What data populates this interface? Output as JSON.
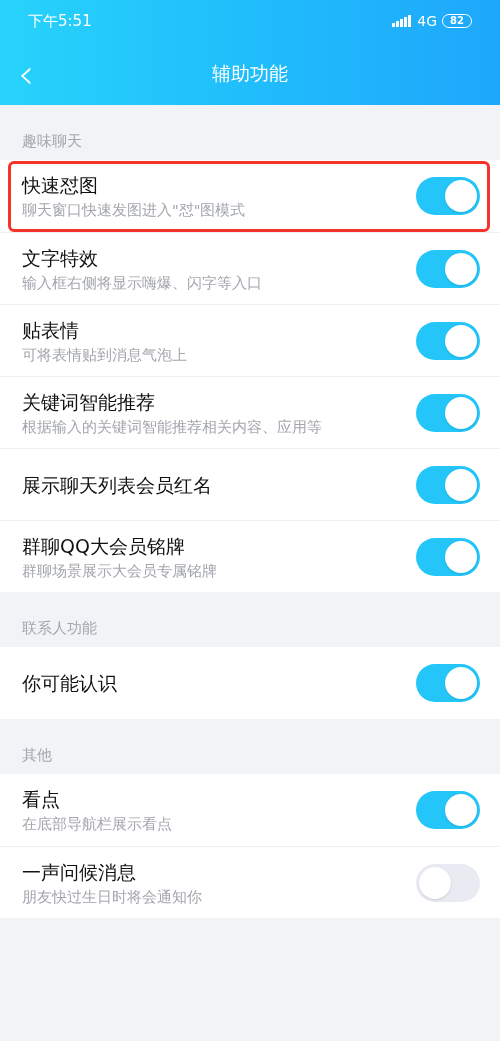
{
  "status_bar": {
    "time": "下午5:51",
    "network": "4G",
    "battery": "82"
  },
  "header": {
    "back": "‹",
    "title": "辅助功能"
  },
  "sections": [
    {
      "title": "趣味聊天",
      "items": [
        {
          "title": "快速怼图",
          "subtitle": "聊天窗口快速发图进入\"怼\"图模式",
          "on": true,
          "highlighted": true
        },
        {
          "title": "文字特效",
          "subtitle": "输入框右侧将显示嗨爆、闪字等入口",
          "on": true,
          "highlighted": false
        },
        {
          "title": "贴表情",
          "subtitle": "可将表情贴到消息气泡上",
          "on": true,
          "highlighted": false
        },
        {
          "title": "关键词智能推荐",
          "subtitle": "根据输入的关键词智能推荐相关内容、应用等",
          "on": true,
          "highlighted": false
        },
        {
          "title": "展示聊天列表会员红名",
          "on": true,
          "highlighted": false
        },
        {
          "title": "群聊QQ大会员铭牌",
          "subtitle": "群聊场景展示大会员专属铭牌",
          "on": true,
          "highlighted": false
        }
      ]
    },
    {
      "title": "联系人功能",
      "items": [
        {
          "title": "你可能认识",
          "on": true,
          "highlighted": false
        }
      ]
    },
    {
      "title": "其他",
      "items": [
        {
          "title": "看点",
          "subtitle": "在底部导航栏展示看点",
          "on": true,
          "highlighted": false
        },
        {
          "title": "一声问候消息",
          "subtitle": "朋友快过生日时将会通知你",
          "on": false,
          "highlighted": false
        }
      ]
    }
  ]
}
